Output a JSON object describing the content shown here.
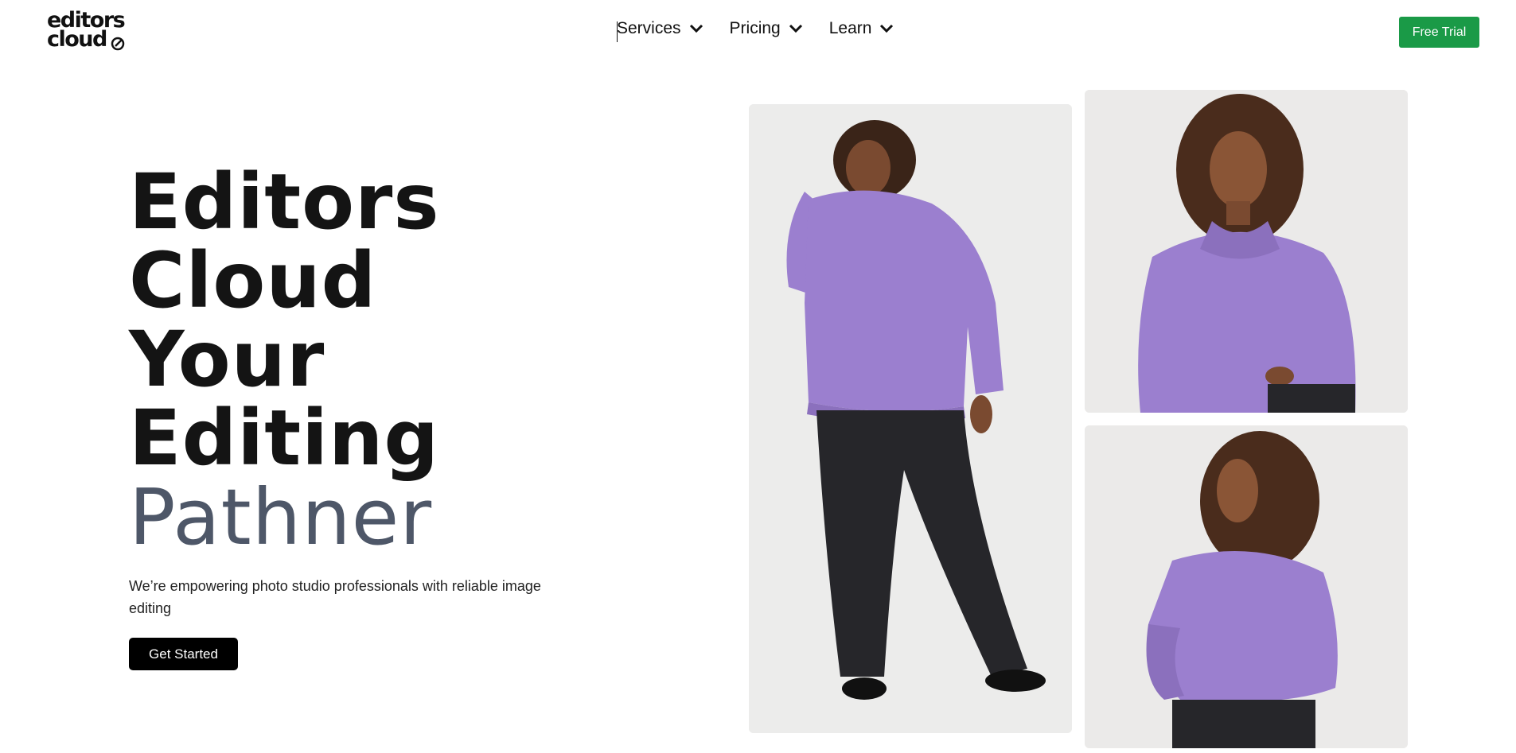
{
  "logo": {
    "line1": "editors",
    "line2": "cloud"
  },
  "nav": {
    "items": [
      {
        "label": "Services"
      },
      {
        "label": "Pricing"
      },
      {
        "label": "Learn"
      }
    ]
  },
  "header": {
    "cta_label": "Free Trial"
  },
  "hero": {
    "lines": [
      "Editors",
      "Cloud",
      "Your",
      "Editing"
    ],
    "accent": "Pathner",
    "subtitle": "We’re empowering photo studio professionals with reliable image editing",
    "cta_label": "Get Started"
  },
  "gallery": {
    "photos": [
      {
        "icon": "model-full-body-photo"
      },
      {
        "icon": "model-front-portrait-photo"
      },
      {
        "icon": "model-back-view-photo"
      }
    ]
  },
  "colors": {
    "accent_green": "#1a9a47",
    "hoodie_purple": "#9b7fcf",
    "pants_black": "#26262a",
    "accent_text": "#4e5768"
  }
}
